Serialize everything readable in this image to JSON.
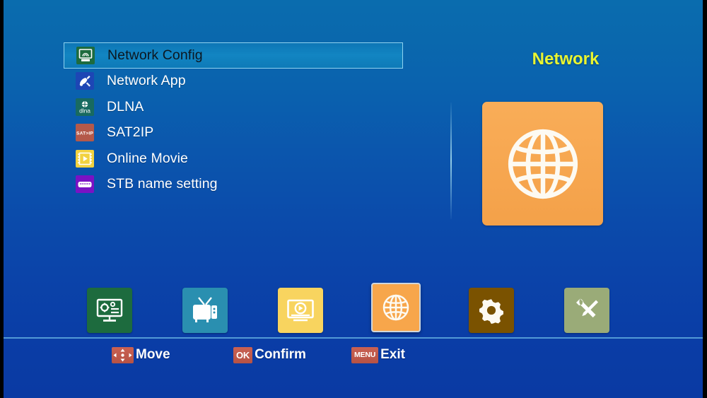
{
  "screen": {
    "background_top_color": "#0a6cae",
    "background_bottom_color": "#0a3aa3"
  },
  "menu": {
    "items": [
      {
        "label": "Network Config",
        "icon": "network-config-icon",
        "icon_bg": "#1d6b3e",
        "selected": true
      },
      {
        "label": "Network App",
        "icon": "network-app-icon",
        "icon_bg": "#1d46b5",
        "selected": false
      },
      {
        "label": "DLNA",
        "icon": "dlna-icon",
        "icon_bg": "#186a60",
        "selected": false
      },
      {
        "label": "SAT2IP",
        "icon": "sat2ip-icon",
        "icon_bg": "#b4594a",
        "selected": false
      },
      {
        "label": "Online Movie",
        "icon": "online-movie-icon",
        "icon_bg": "#f2d23f",
        "selected": false
      },
      {
        "label": "STB name setting",
        "icon": "stb-name-icon",
        "icon_bg": "#7a12c4",
        "selected": false
      }
    ],
    "selected_index": 0,
    "highlight_border_color": "#8fd3f0",
    "highlight_fill_color": "#1285c2"
  },
  "panel": {
    "title": "Network",
    "title_color": "#e9f531",
    "preview_icon": "globe-icon",
    "preview_bg_color": "#f7a64b"
  },
  "categories": {
    "active_index": 3,
    "items": [
      {
        "name": "installation",
        "icon": "monitor-settings-icon",
        "bg_color": "#1d6b3e",
        "active": false
      },
      {
        "name": "channel",
        "icon": "tv-icon",
        "bg_color": "#2a8fb0",
        "active": false
      },
      {
        "name": "media",
        "icon": "media-player-icon",
        "bg_color": "#f8d45f",
        "active": false
      },
      {
        "name": "network",
        "icon": "globe-icon",
        "bg_color": "#f7a64b",
        "active": true
      },
      {
        "name": "system",
        "icon": "gear-icon",
        "bg_color": "#7a5200",
        "active": false
      },
      {
        "name": "tools",
        "icon": "tools-icon",
        "bg_color": "#9aab78",
        "active": false
      }
    ]
  },
  "hints": {
    "items": [
      {
        "key": "arrows",
        "key_label": "",
        "label": "Move"
      },
      {
        "key": "ok",
        "key_label": "OK",
        "label": "Confirm"
      },
      {
        "key": "menu",
        "key_label": "MENU",
        "label": "Exit"
      }
    ],
    "badge_color": "#bf5a4a"
  }
}
